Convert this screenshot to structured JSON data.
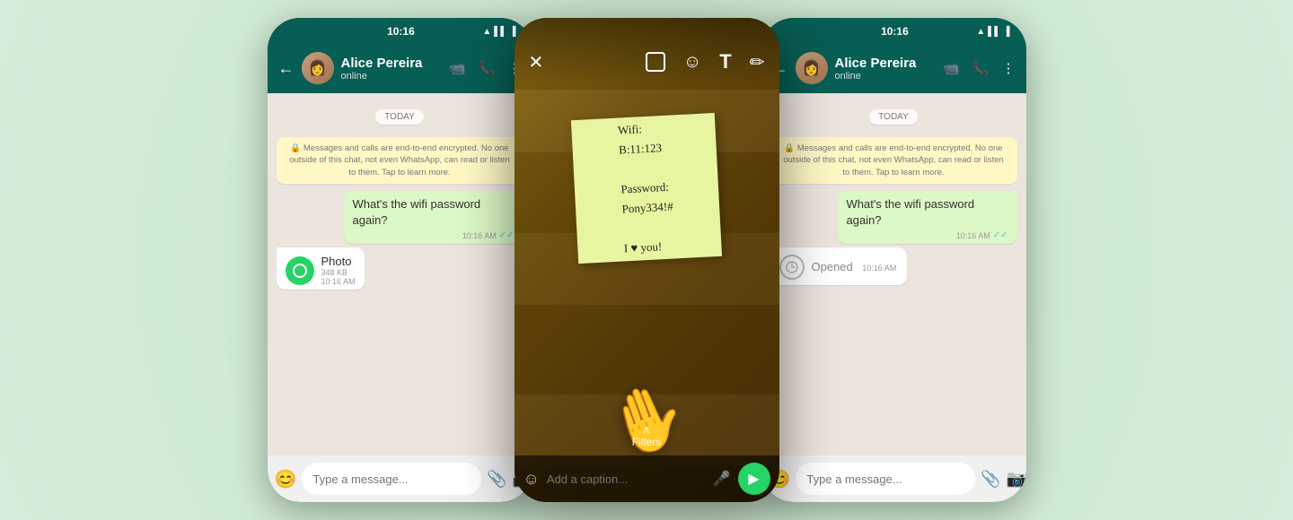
{
  "background_color": "#c8e6c9",
  "phones": [
    {
      "id": "phone-left",
      "type": "chat",
      "status_bar": {
        "time": "10:16",
        "icons": [
          "wifi",
          "signal",
          "battery"
        ]
      },
      "header": {
        "contact_name": "Alice Pereira",
        "contact_status": "online",
        "actions": [
          "video",
          "call",
          "more"
        ]
      },
      "chat": {
        "date_divider": "TODAY",
        "encryption_notice": "🔒 Messages and calls are end-to-end encrypted. No one outside of this chat, not even WhatsApp, can read or listen to them. Tap to learn more.",
        "messages": [
          {
            "type": "sent",
            "text": "What's the wifi password again?",
            "time": "10:16 AM",
            "status": "read"
          },
          {
            "type": "received_photo",
            "label": "Photo",
            "size": "348 KB",
            "time": "10:16 AM"
          }
        ]
      },
      "input_placeholder": "Type a message..."
    },
    {
      "id": "phone-middle",
      "type": "photo-viewer",
      "toolbar": {
        "left_icons": [
          "close"
        ],
        "right_icons": [
          "crop",
          "emoji",
          "text",
          "draw"
        ]
      },
      "sticky_note_content": "Wifi:\nB:11:123\n\nPassword:\nPony334!#\n\nI ♥ you!",
      "filters_label": "Filters",
      "caption_placeholder": "Add a caption...",
      "send_button_label": "Send"
    },
    {
      "id": "phone-right",
      "type": "chat",
      "status_bar": {
        "time": "10:16",
        "icons": [
          "wifi",
          "signal",
          "battery"
        ]
      },
      "header": {
        "contact_name": "Alice Pereira",
        "contact_status": "online",
        "actions": [
          "video",
          "call",
          "more"
        ]
      },
      "chat": {
        "date_divider": "TODAY",
        "encryption_notice": "🔒 Messages and calls are end-to-end encrypted. No one outside of this chat, not even WhatsApp, can read or listen to them. Tap to learn more.",
        "messages": [
          {
            "type": "sent",
            "text": "What's the wifi password again?",
            "time": "10:16 AM",
            "status": "read"
          },
          {
            "type": "opened",
            "label": "Opened",
            "time": "10:16 AM"
          }
        ]
      },
      "input_placeholder": "Type a message..."
    }
  ],
  "icons": {
    "back": "←",
    "video": "📹",
    "call": "📞",
    "more": "⋮",
    "close": "✕",
    "crop": "⊡",
    "emoji": "☺",
    "text": "T",
    "draw": "✏",
    "mic": "🎤",
    "attach": "📎",
    "camera": "📷",
    "send": "➤",
    "check_double": "✓✓",
    "wifi": "▲",
    "signal": "▌",
    "battery": "▐"
  }
}
